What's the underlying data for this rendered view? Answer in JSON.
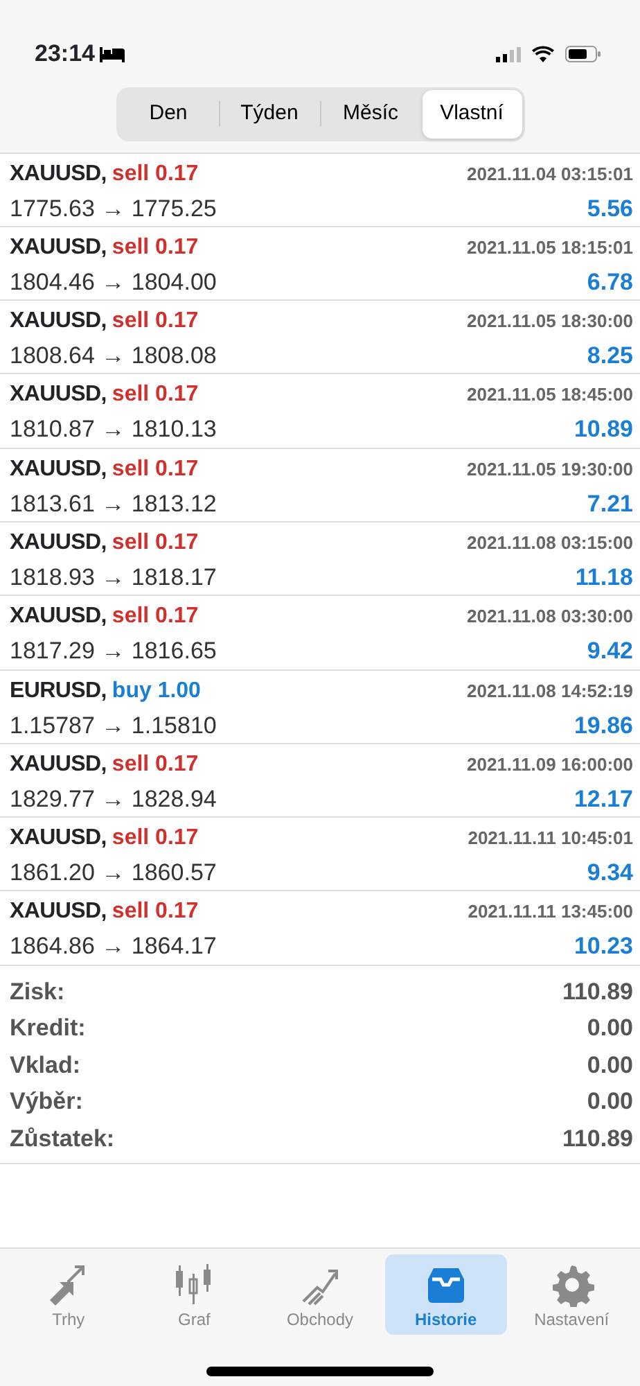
{
  "status_bar": {
    "time": "23:14"
  },
  "segments": [
    {
      "label": "Den",
      "selected": false
    },
    {
      "label": "Týden",
      "selected": false
    },
    {
      "label": "Měsíc",
      "selected": false
    },
    {
      "label": "Vlastní",
      "selected": true
    }
  ],
  "trades": [
    {
      "symbol": "XAUUSD,",
      "side": "sell",
      "lots": "0.17",
      "color": "#d0312d",
      "time": "2021.11.04 03:15:01",
      "prices": "1775.63 → 1775.25",
      "profit": "5.56"
    },
    {
      "symbol": "XAUUSD,",
      "side": "sell",
      "lots": "0.17",
      "color": "#d0312d",
      "time": "2021.11.05 18:15:01",
      "prices": "1804.46 → 1804.00",
      "profit": "6.78"
    },
    {
      "symbol": "XAUUSD,",
      "side": "sell",
      "lots": "0.17",
      "color": "#d0312d",
      "time": "2021.11.05 18:30:00",
      "prices": "1808.64 → 1808.08",
      "profit": "8.25"
    },
    {
      "symbol": "XAUUSD,",
      "side": "sell",
      "lots": "0.17",
      "color": "#d0312d",
      "time": "2021.11.05 18:45:00",
      "prices": "1810.87 → 1810.13",
      "profit": "10.89"
    },
    {
      "symbol": "XAUUSD,",
      "side": "sell",
      "lots": "0.17",
      "color": "#d0312d",
      "time": "2021.11.05 19:30:00",
      "prices": "1813.61 → 1813.12",
      "profit": "7.21"
    },
    {
      "symbol": "XAUUSD,",
      "side": "sell",
      "lots": "0.17",
      "color": "#d0312d",
      "time": "2021.11.08 03:15:00",
      "prices": "1818.93 → 1818.17",
      "profit": "11.18"
    },
    {
      "symbol": "XAUUSD,",
      "side": "sell",
      "lots": "0.17",
      "color": "#d0312d",
      "time": "2021.11.08 03:30:00",
      "prices": "1817.29 → 1816.65",
      "profit": "9.42"
    },
    {
      "symbol": "EURUSD,",
      "side": "buy",
      "lots": "1.00",
      "color": "#1a7fd4",
      "time": "2021.11.08 14:52:19",
      "prices": "1.15787 → 1.15810",
      "profit": "19.86"
    },
    {
      "symbol": "XAUUSD,",
      "side": "sell",
      "lots": "0.17",
      "color": "#d0312d",
      "time": "2021.11.09 16:00:00",
      "prices": "1829.77 → 1828.94",
      "profit": "12.17"
    },
    {
      "symbol": "XAUUSD,",
      "side": "sell",
      "lots": "0.17",
      "color": "#d0312d",
      "time": "2021.11.11 10:45:01",
      "prices": "1861.20 → 1860.57",
      "profit": "9.34"
    },
    {
      "symbol": "XAUUSD,",
      "side": "sell",
      "lots": "0.17",
      "color": "#d0312d",
      "time": "2021.11.11 13:45:00",
      "prices": "1864.86 → 1864.17",
      "profit": "10.23"
    }
  ],
  "summary": [
    {
      "label": "Zisk:",
      "value": "110.89"
    },
    {
      "label": "Kredit:",
      "value": "0.00"
    },
    {
      "label": "Vklad:",
      "value": "0.00"
    },
    {
      "label": "Výběr:",
      "value": "0.00"
    },
    {
      "label": "Zůstatek:",
      "value": "110.89"
    }
  ],
  "tab_bar": [
    {
      "kind": "arrows",
      "label": "Trhy",
      "selected": false
    },
    {
      "kind": "candles",
      "label": "Graf",
      "selected": false
    },
    {
      "kind": "trend",
      "label": "Obchody",
      "selected": false
    },
    {
      "kind": "tray",
      "label": "Historie",
      "selected": true
    },
    {
      "kind": "gear",
      "label": "Nastavení",
      "selected": false
    }
  ]
}
